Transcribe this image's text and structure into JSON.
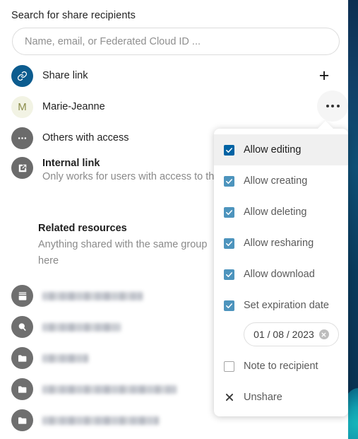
{
  "share_panel": {
    "search_label": "Search for share recipients",
    "search_placeholder": "Name, email, or Federated Cloud ID ...",
    "search_value": "",
    "add_label": "+",
    "rows": [
      {
        "icon": "link-icon",
        "label": "Share link"
      },
      {
        "icon": "avatar-initial",
        "label": "Marie-Jeanne",
        "initial": "M"
      },
      {
        "icon": "more-dots-icon",
        "label": "Others with access"
      },
      {
        "icon": "external-link-icon",
        "label": "Internal link",
        "sub": "Only works for users with access to th"
      }
    ]
  },
  "related_resources": {
    "title": "Related resources",
    "description": "Anything shared with the same group",
    "description_line2": "here",
    "items": [
      {
        "icon": "archive-icon",
        "redacted_width": 142
      },
      {
        "icon": "search-circle-icon",
        "redacted_width": 111
      },
      {
        "icon": "folder-icon",
        "redacted_width": 65
      },
      {
        "icon": "folder-icon",
        "redacted_width": 190
      },
      {
        "icon": "folder-icon",
        "redacted_width": 165
      }
    ]
  },
  "permissions_menu": {
    "items": [
      {
        "label": "Allow editing",
        "state": "checked-strong",
        "active": true
      },
      {
        "label": "Allow creating",
        "state": "checked-muted",
        "active": false
      },
      {
        "label": "Allow deleting",
        "state": "checked-muted",
        "active": false
      },
      {
        "label": "Allow resharing",
        "state": "checked-muted",
        "active": false
      },
      {
        "label": "Allow download",
        "state": "checked-muted",
        "active": false
      },
      {
        "label": "Set expiration date",
        "state": "checked-muted",
        "active": false
      }
    ],
    "expiration_date": "01 / 08 / 2023",
    "note_label": "Note to recipient",
    "note_state": "unchecked",
    "unshare_label": "Unshare"
  },
  "colors": {
    "accent_strong": "#0063a4",
    "accent_muted": "#4d94bd",
    "link_avatar": "#0c5c8f",
    "gray_avatar": "#6b6b6b",
    "initial_bg": "#f2f3e4",
    "initial_fg": "#8b8c4a",
    "desktop_strip": "#123f66",
    "teal_blob": "#17b6ba"
  }
}
